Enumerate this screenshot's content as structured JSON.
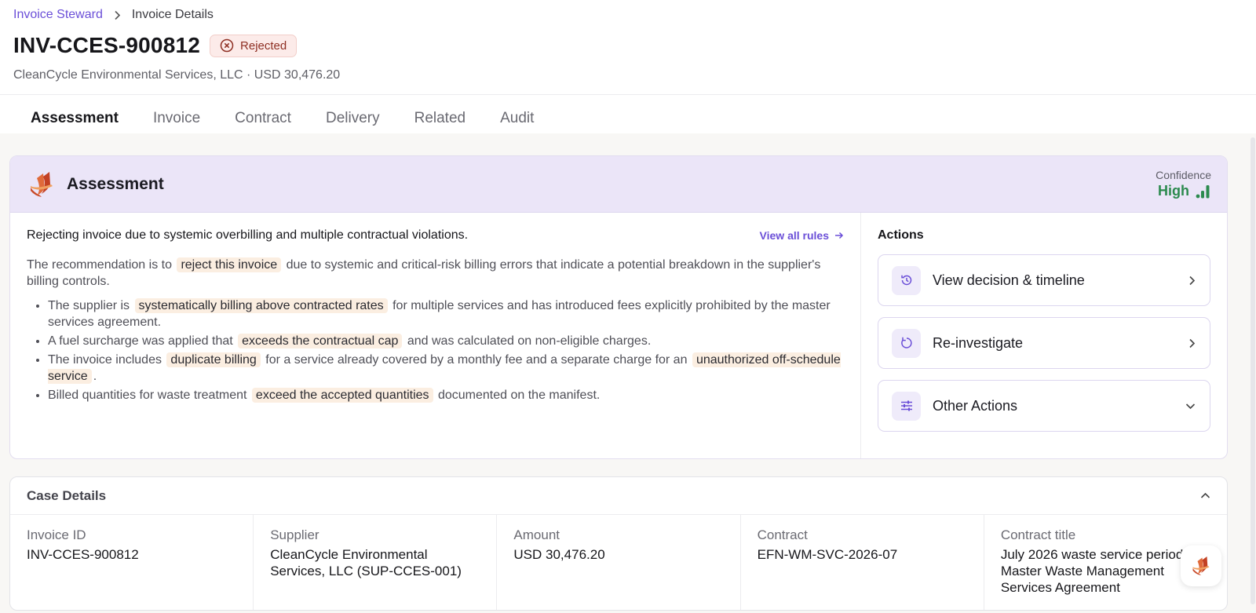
{
  "breadcrumb": {
    "root": "Invoice Steward",
    "current": "Invoice Details"
  },
  "header": {
    "title": "INV-CCES-900812",
    "status": "Rejected",
    "subtitle": "CleanCycle Environmental Services, LLC · USD 30,476.20"
  },
  "tabs": [
    "Assessment",
    "Invoice",
    "Contract",
    "Delivery",
    "Related",
    "Audit"
  ],
  "active_tab": "Assessment",
  "assessment": {
    "title": "Assessment",
    "confidence_label": "Confidence",
    "confidence_value": "High",
    "summary": "Rejecting invoice due to systemic overbilling and multiple contractual violations.",
    "rules_link": "View all rules",
    "para_before": "The recommendation is to",
    "para_highlight": "reject this invoice",
    "para_after": "due to systemic and critical-risk billing errors that indicate a potential breakdown in the supplier's billing controls.",
    "findings": [
      {
        "before": "The supplier is",
        "hl": "systematically billing above contracted rates",
        "after": "for multiple services and has introduced fees explicitly prohibited by the master services agreement."
      },
      {
        "before": "A fuel surcharge was applied that",
        "hl": "exceeds the contractual cap",
        "after": "and was calculated on non-eligible charges."
      },
      {
        "before": "The invoice includes",
        "hl": "duplicate billing",
        "mid": "for a service already covered by a monthly fee and a separate charge for an",
        "hl2": "unauthorized off-schedule service",
        "after": "."
      },
      {
        "before": "Billed quantities for waste treatment",
        "hl": "exceed the accepted quantities",
        "after": "documented on the manifest."
      }
    ],
    "actions_label": "Actions",
    "actions": [
      "View decision & timeline",
      "Re-investigate",
      "Other Actions"
    ]
  },
  "case_details": {
    "title": "Case Details",
    "fields": [
      {
        "label": "Invoice ID",
        "value": "INV-CCES-900812"
      },
      {
        "label": "Supplier",
        "value": "CleanCycle Environmental Services, LLC (SUP-CCES-001)"
      },
      {
        "label": "Amount",
        "value": "USD 30,476.20"
      },
      {
        "label": "Contract",
        "value": "EFN-WM-SVC-2026-07"
      },
      {
        "label": "Contract title",
        "value": "July 2026 waste service period - Master Waste Management Services Agreement"
      }
    ]
  },
  "colors": {
    "accent": "#5a46c8",
    "link": "#6b4fd8",
    "confidence_high": "#2b8a4e",
    "rejected": "#8e2f23"
  }
}
